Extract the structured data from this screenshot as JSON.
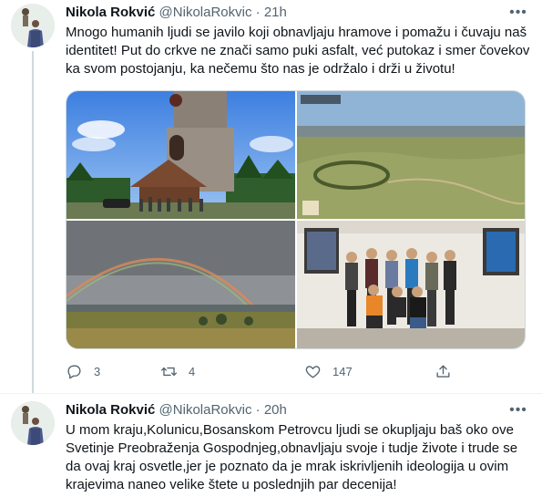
{
  "tweets": [
    {
      "name": "Nikola Rokvić",
      "handle": "@NikolaRokvic",
      "time": "21h",
      "text": "Mnogo humanih ljudi se javilo koji obnavljaju hramove i pomažu i čuvaju naš identitet! Put do crkve ne znači samo puki asfalt, već putokaz i smer čovekov ka svom postojanju, ka nečemu što nas je održalo i drži u životu!",
      "media": [
        {
          "icon": "church-photo"
        },
        {
          "icon": "aerial-landscape-photo"
        },
        {
          "icon": "rainbow-photo"
        },
        {
          "icon": "group-photo"
        }
      ],
      "actions": {
        "replies": "3",
        "retweets": "4",
        "likes": "147"
      }
    },
    {
      "name": "Nikola Rokvić",
      "handle": "@NikolaRokvic",
      "time": "20h",
      "text": "U mom kraju,Kolunicu,Bosanskom Petrovcu ljudi se okupljaju baš oko ove Svetinje Preobraženja Gospodnjeg,obnavljaju svoje i tudje živote i trude se da ovaj kraj osvetle,jer je poznato da je mrak iskrivljenih ideologija u ovim krajevima naneo velike štete u poslednjih par decenija!"
    }
  ],
  "separator": "·",
  "colors": {
    "text": "#0f1419",
    "secondary": "#536471",
    "border": "#cfd9de",
    "divider": "#eff3f4"
  }
}
